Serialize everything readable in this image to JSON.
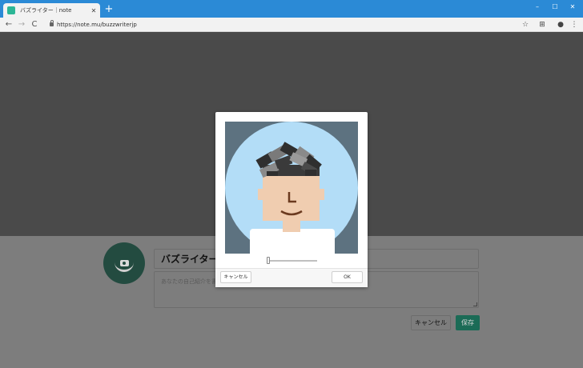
{
  "browser": {
    "tab": {
      "title": "バズライター｜note",
      "close_glyph": "✕"
    },
    "new_tab_glyph": "+",
    "window_controls": {
      "minimize": "–",
      "maximize": "☐",
      "close": "✕"
    },
    "nav": {
      "back": "←",
      "forward": "→",
      "reload": "C"
    },
    "url": "https://note.mu/buzzwriterjp",
    "toolbar_icons": {
      "bookmark": "☆",
      "extension": "⊞",
      "profile": "●",
      "menu": "⋮"
    }
  },
  "page": {
    "name_value": "バズライター",
    "bio_placeholder": "あなたの自己紹介を書",
    "cancel_label": "キャンセル",
    "save_label": "保存"
  },
  "modal": {
    "zoom_level": 0,
    "cancel_label": "キャンセル",
    "ok_label": "OK"
  },
  "colors": {
    "brand": "#2cb696",
    "title_bar": "#2b8ad6",
    "crop_circle": "#b3ddf7",
    "crop_background": "#5d7280"
  }
}
